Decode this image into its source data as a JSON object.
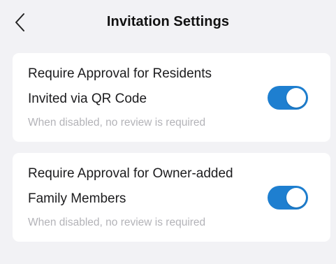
{
  "header": {
    "title": "Invitation Settings",
    "back_icon": "chevron-left-icon"
  },
  "settings": [
    {
      "title_line1": "Require Approval for Residents",
      "title_line2": "Invited via QR Code",
      "description": "When disabled, no review is required",
      "enabled": true
    },
    {
      "title_line1": "Require Approval for Owner-added",
      "title_line2": "Family Members",
      "description": "When disabled, no review is required",
      "enabled": true
    }
  ],
  "colors": {
    "background": "#f2f2f5",
    "card": "#ffffff",
    "toggle_on": "#1e7fd0",
    "description_text": "#b3b3b8"
  }
}
